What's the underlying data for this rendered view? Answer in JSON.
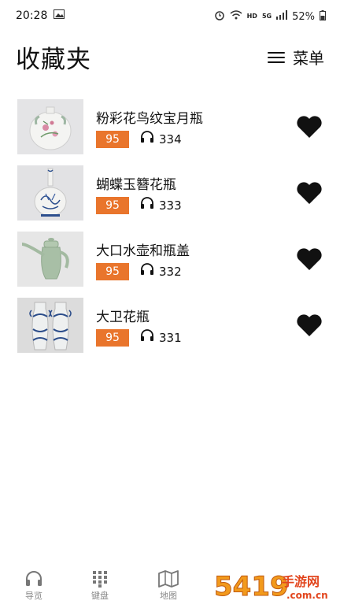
{
  "status": {
    "time": "20:28",
    "hd": "HD",
    "network": "5G",
    "battery": "52%"
  },
  "header": {
    "title": "收藏夹",
    "menu_label": "菜单"
  },
  "items": [
    {
      "title": "粉彩花鸟纹宝月瓶",
      "score": "95",
      "listens": "334"
    },
    {
      "title": "蝴蝶玉簪花瓶",
      "score": "95",
      "listens": "333"
    },
    {
      "title": "大口水壶和瓶盖",
      "score": "95",
      "listens": "332"
    },
    {
      "title": "大卫花瓶",
      "score": "95",
      "listens": "331"
    }
  ],
  "tabs": [
    {
      "label": "导览",
      "icon": "headphones-icon"
    },
    {
      "label": "键盘",
      "icon": "keypad-icon"
    },
    {
      "label": "地图",
      "icon": "map-icon"
    }
  ],
  "watermark": {
    "number": "5419",
    "text": "手游网",
    "domain": ".com.cn"
  },
  "colors": {
    "score_badge": "#e9752c",
    "heart": "#111111",
    "tab_text": "#888888"
  }
}
